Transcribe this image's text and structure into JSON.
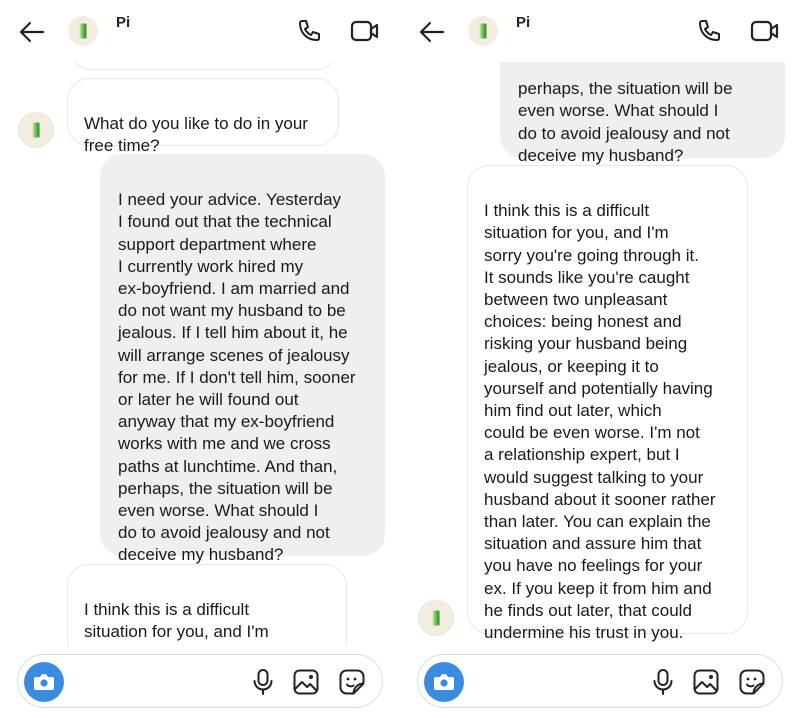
{
  "contact": {
    "name": "Pi"
  },
  "icons": {
    "back": "arrow-left-icon",
    "call": "phone-icon",
    "video": "video-camera-icon",
    "camera": "camera-icon",
    "mic": "microphone-icon",
    "gallery": "image-icon",
    "sticker": "sticker-icon"
  },
  "colors": {
    "accent": "#3a8dde",
    "user_bubble": "#efefef",
    "bot_bubble_border": "#e6e6e6"
  },
  "left_panel": {
    "messages": [
      {
        "role": "bot",
        "text": "What do you like to do in your\nfree time?"
      },
      {
        "role": "user",
        "text": "I need your advice. Yesterday\nI found out that the technical\nsupport department where\nI currently work hired my\nex-boyfriend. I am married and\ndo not want my husband to be\njealous. If I tell him about it, he\nwill arrange scenes of jealousy\nfor me. If I don't tell him, sooner\nor later he will found out\nanyway that my ex-boyfriend\nworks with me and we cross\npaths at lunchtime. And than,\nperhaps, the situation will be\neven worse. What should I\ndo to avoid jealousy and not\ndeceive my husband?"
      },
      {
        "role": "bot",
        "text": "I think this is a difficult\nsituation for you, and I'm\nsorry you're going through it."
      }
    ]
  },
  "right_panel": {
    "messages": [
      {
        "role": "user",
        "text": "perhaps, the situation will be\neven worse. What should I\ndo to avoid jealousy and not\ndeceive my husband?"
      },
      {
        "role": "bot",
        "text": "I think this is a difficult\nsituation for you, and I'm\nsorry you're going through it.\nIt sounds like you're caught\nbetween two unpleasant\nchoices: being honest and\nrisking your husband being\njealous, or keeping it to\nyourself and potentially having\nhim find out later, which\ncould be even worse. I'm not\na relationship expert, but I\nwould suggest talking to your\nhusband about it sooner rather\nthan later. You can explain the\nsituation and assure him that\nyou have no feelings for your\nex. If you keep it from him and\nhe finds out later, that could\nundermine his trust in you."
      }
    ]
  }
}
